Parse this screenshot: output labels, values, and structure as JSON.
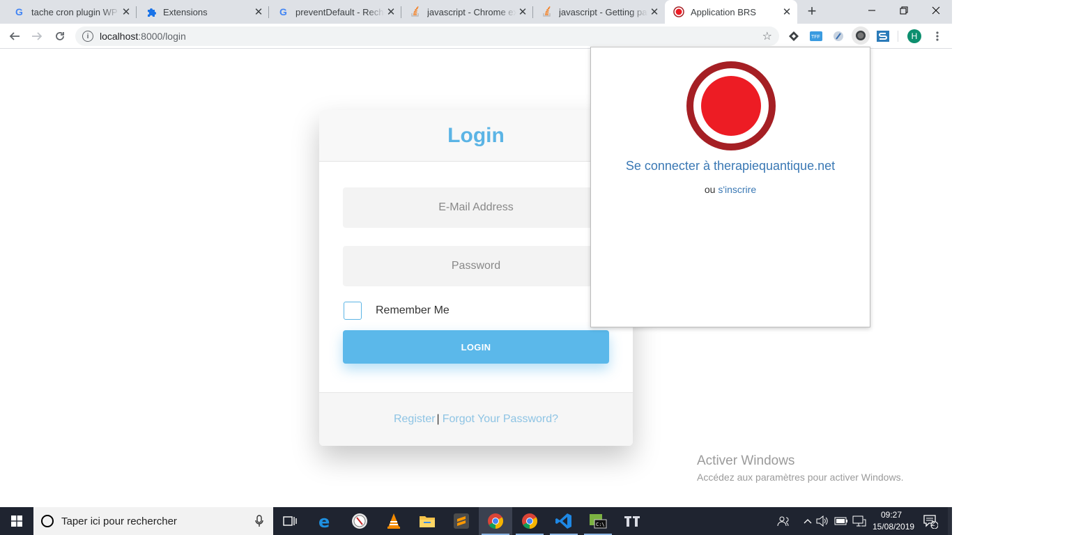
{
  "tabs": [
    {
      "title": "tache cron plugin WP -",
      "icon": "google-icon"
    },
    {
      "title": "Extensions",
      "icon": "puzzle-icon"
    },
    {
      "title": "preventDefault - Recherche",
      "icon": "google-icon"
    },
    {
      "title": "javascript - Chrome extension",
      "icon": "stackoverflow-icon"
    },
    {
      "title": "javascript - Getting parent",
      "icon": "stackoverflow-icon"
    },
    {
      "title": "Application BRS",
      "icon": "red-record-icon",
      "active": true
    }
  ],
  "toolbar": {
    "url_host": "localhost",
    "url_path": ":8000/login",
    "profile_initial": "H"
  },
  "login": {
    "title": "Login",
    "email_placeholder": "E-Mail Address",
    "password_placeholder": "Password",
    "remember_label": "Remember Me",
    "button_label": "LOGIN",
    "register_link": "Register",
    "separator": "|",
    "forgot_link": "Forgot Your Password?"
  },
  "popup": {
    "connect_text": "Se connecter à therapiequantique.net",
    "or_text": "ou",
    "signup_link": "s'inscrire",
    "logo_color": "#ed1c24",
    "ring_color": "#a51f24"
  },
  "watermark": {
    "title": "Activer Windows",
    "subtitle": "Accédez aux paramètres pour activer Windows."
  },
  "taskbar": {
    "search_placeholder": "Taper ici pour rechercher",
    "time": "09:27",
    "date": "15/08/2019",
    "notification_count": "2"
  },
  "colors": {
    "accent": "#5bb8ea",
    "taskbar": "#1f2430"
  }
}
